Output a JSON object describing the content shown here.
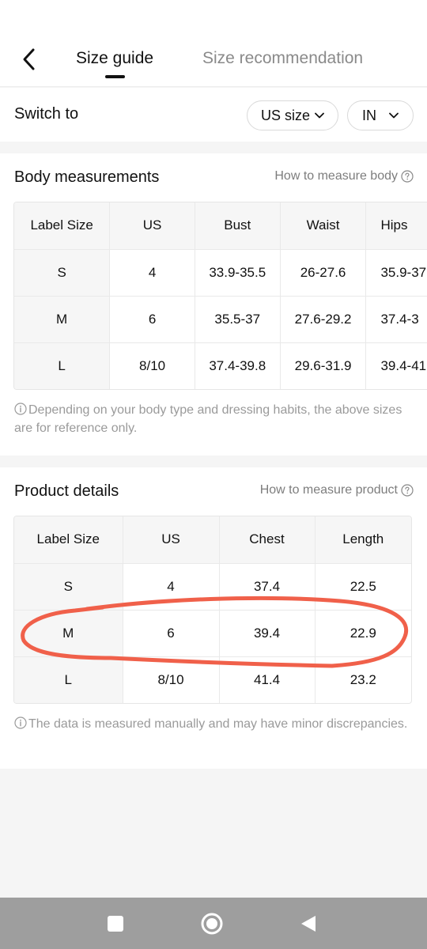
{
  "header": {
    "tabs": [
      {
        "label": "Size guide",
        "active": true
      },
      {
        "label": "Size recommendation",
        "active": false
      }
    ]
  },
  "switch": {
    "label": "Switch to",
    "size_system": "US size",
    "unit": "IN"
  },
  "body_measurements": {
    "title": "Body measurements",
    "link": "How to measure body",
    "columns": [
      "Label Size",
      "US",
      "Bust",
      "Waist",
      "Hips"
    ],
    "rows": [
      [
        "S",
        "4",
        "33.9-35.5",
        "26-27.6",
        "35.9-37"
      ],
      [
        "M",
        "6",
        "35.5-37",
        "27.6-29.2",
        "37.4-3"
      ],
      [
        "L",
        "8/10",
        "37.4-39.8",
        "29.6-31.9",
        "39.4-41"
      ]
    ],
    "note": "Depending on your body type and dressing habits, the above sizes are for reference only."
  },
  "product_details": {
    "title": "Product details",
    "link": "How to measure product",
    "columns": [
      "Label Size",
      "US",
      "Chest",
      "Length"
    ],
    "rows": [
      [
        "S",
        "4",
        "37.4",
        "22.5"
      ],
      [
        "M",
        "6",
        "39.4",
        "22.9"
      ],
      [
        "L",
        "8/10",
        "41.4",
        "23.2"
      ]
    ],
    "note": "The data is measured manually and may have minor discrepancies."
  },
  "annotation": {
    "color": "#f0604a",
    "highlighted_row": "M"
  },
  "navbar": {
    "icons": [
      "recents-square-icon",
      "home-circle-icon",
      "back-triangle-icon"
    ]
  }
}
